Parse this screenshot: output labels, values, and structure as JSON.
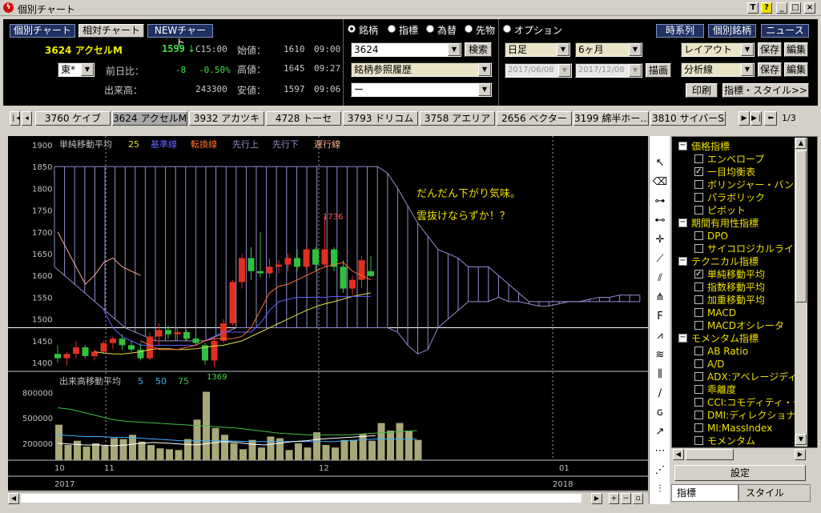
{
  "window": {
    "title": "個別チャート",
    "controls": [
      "T",
      "?",
      "_",
      "□",
      "×"
    ]
  },
  "nav": {
    "individual": "個別チャート",
    "relative": "相対チャート",
    "new": "NEWチャート"
  },
  "quote": {
    "code_name": "3624 アクセルM",
    "price": "1599",
    "arrow": "↓",
    "time_flag": "C15:00",
    "market": "東*",
    "prev_label": "前日比：",
    "prev_change": "-8",
    "prev_pct": "-0.50%",
    "volume_label": "出来高：",
    "volume": "243300",
    "open_label": "始値：",
    "open": "1610",
    "open_time": "09:00",
    "high_label": "高値：",
    "high": "1645",
    "high_time": "09:27",
    "low_label": "安値：",
    "low": "1597",
    "low_time": "09:06"
  },
  "radios": [
    {
      "label": "銘柄",
      "checked": true
    },
    {
      "label": "指標",
      "checked": false
    },
    {
      "label": "為替",
      "checked": false
    },
    {
      "label": "先物",
      "checked": false
    },
    {
      "label": "オプション",
      "checked": false
    }
  ],
  "search": {
    "code": "3624",
    "button": "検索",
    "history": "銘柄参照履歴",
    "third": "ー"
  },
  "period": {
    "type": "日足",
    "range": "6ヶ月",
    "from": "2017/06/08",
    "to": "2017/12/08",
    "draw": "描画"
  },
  "right_buttons": {
    "timeseries": "時系列",
    "individual": "個別銘柄",
    "news": "ニュース"
  },
  "layout": {
    "layout": "レイアウト",
    "save": "保存",
    "edit": "編集",
    "analysis": "分析線",
    "print": "印刷",
    "indicator_style": "指標・スタイル>>"
  },
  "tabs": [
    "3760 ケイブ",
    "3624 アクセルM",
    "3932 アカツキ",
    "4728 トーセ",
    "3793 ドリコム",
    "3758 アエリア",
    "2656 ベクター",
    "3199 綿半ホー…",
    "3810 サイバーS"
  ],
  "tab_page": "1/3",
  "chart": {
    "legend": {
      "sma": "単純移動平均",
      "sma_n": "25",
      "base": "基準線",
      "conv": "転換線",
      "lead1": "先行上",
      "lead2": "先行下",
      "lag": "遅行線"
    },
    "comment1": "だんだん下がり気味。",
    "comment2": "雲抜けならずか！？",
    "high_marker": "1736",
    "low_marker": "1369",
    "vol_legend": {
      "label": "出来高移動平均",
      "p1": "5",
      "p2": "50",
      "p3": "75"
    },
    "y_ticks": [
      "1900",
      "1850",
      "1800",
      "1750",
      "1700",
      "1650",
      "1600",
      "1550",
      "1500",
      "1450",
      "1400"
    ],
    "vol_ticks": [
      "800000",
      "500000",
      "200000"
    ],
    "x_months": [
      "10",
      "11",
      "12",
      "01"
    ],
    "x_years": [
      "2017",
      "2018"
    ],
    "colors": {
      "up": "#e03020",
      "down": "#30c040",
      "sma": "#e0e040",
      "base": "#6060ff",
      "conv": "#ff7030",
      "cloud": "#9090d0",
      "lag": "#ffb090"
    }
  },
  "chart_data": {
    "type": "candlestick",
    "ylim": [
      1380,
      1920
    ],
    "candles": [
      {
        "o": 1420,
        "h": 1440,
        "l": 1400,
        "c": 1410
      },
      {
        "o": 1410,
        "h": 1425,
        "l": 1395,
        "c": 1420
      },
      {
        "o": 1420,
        "h": 1450,
        "l": 1410,
        "c": 1435
      },
      {
        "o": 1435,
        "h": 1440,
        "l": 1410,
        "c": 1415
      },
      {
        "o": 1415,
        "h": 1430,
        "l": 1405,
        "c": 1425
      },
      {
        "o": 1425,
        "h": 1450,
        "l": 1420,
        "c": 1445
      },
      {
        "o": 1445,
        "h": 1460,
        "l": 1430,
        "c": 1455
      },
      {
        "o": 1455,
        "h": 1465,
        "l": 1430,
        "c": 1440
      },
      {
        "o": 1440,
        "h": 1450,
        "l": 1425,
        "c": 1430
      },
      {
        "o": 1430,
        "h": 1445,
        "l": 1405,
        "c": 1410
      },
      {
        "o": 1410,
        "h": 1470,
        "l": 1405,
        "c": 1460
      },
      {
        "o": 1460,
        "h": 1490,
        "l": 1440,
        "c": 1475
      },
      {
        "o": 1475,
        "h": 1485,
        "l": 1455,
        "c": 1465
      },
      {
        "o": 1465,
        "h": 1480,
        "l": 1450,
        "c": 1470
      },
      {
        "o": 1470,
        "h": 1475,
        "l": 1450,
        "c": 1455
      },
      {
        "o": 1455,
        "h": 1465,
        "l": 1440,
        "c": 1445
      },
      {
        "o": 1440,
        "h": 1445,
        "l": 1395,
        "c": 1405
      },
      {
        "o": 1405,
        "h": 1460,
        "l": 1390,
        "c": 1450
      },
      {
        "o": 1450,
        "h": 1500,
        "l": 1445,
        "c": 1490
      },
      {
        "o": 1490,
        "h": 1590,
        "l": 1485,
        "c": 1585
      },
      {
        "o": 1585,
        "h": 1650,
        "l": 1570,
        "c": 1640
      },
      {
        "o": 1640,
        "h": 1665,
        "l": 1590,
        "c": 1610
      },
      {
        "o": 1610,
        "h": 1700,
        "l": 1595,
        "c": 1605
      },
      {
        "o": 1605,
        "h": 1640,
        "l": 1595,
        "c": 1620
      },
      {
        "o": 1620,
        "h": 1635,
        "l": 1605,
        "c": 1625
      },
      {
        "o": 1625,
        "h": 1650,
        "l": 1610,
        "c": 1640
      },
      {
        "o": 1640,
        "h": 1660,
        "l": 1610,
        "c": 1620
      },
      {
        "o": 1620,
        "h": 1665,
        "l": 1615,
        "c": 1660
      },
      {
        "o": 1660,
        "h": 1665,
        "l": 1610,
        "c": 1625
      },
      {
        "o": 1625,
        "h": 1736,
        "l": 1620,
        "c": 1660
      },
      {
        "o": 1660,
        "h": 1665,
        "l": 1610,
        "c": 1620
      },
      {
        "o": 1620,
        "h": 1635,
        "l": 1560,
        "c": 1570
      },
      {
        "o": 1570,
        "h": 1600,
        "l": 1555,
        "c": 1590
      },
      {
        "o": 1590,
        "h": 1645,
        "l": 1570,
        "c": 1635
      },
      {
        "o": 1610,
        "h": 1645,
        "l": 1597,
        "c": 1599
      }
    ],
    "volume": [
      420000,
      180000,
      230000,
      160000,
      200000,
      170000,
      260000,
      250000,
      300000,
      220000,
      180000,
      140000,
      130000,
      120000,
      250000,
      480000,
      810000,
      380000,
      300000,
      200000,
      130000,
      240000,
      150000,
      280000,
      260000,
      120000,
      200000,
      150000,
      330000,
      180000,
      150000,
      240000,
      240000,
      310000,
      230000,
      440000,
      350000,
      440000,
      350000,
      240000
    ],
    "current_price_line": 1480
  },
  "side": {
    "items": [
      {
        "type": "group",
        "label": "価格指標"
      },
      {
        "type": "item",
        "label": "エンベロープ",
        "checked": false
      },
      {
        "type": "item",
        "label": "一目均衡表",
        "checked": true
      },
      {
        "type": "item",
        "label": "ボリンジャー・バンド",
        "checked": false
      },
      {
        "type": "item",
        "label": "パラボリック",
        "checked": false
      },
      {
        "type": "item",
        "label": "ピボット",
        "checked": false
      },
      {
        "type": "group",
        "label": "期間有用性指標"
      },
      {
        "type": "item",
        "label": "DPO",
        "checked": false
      },
      {
        "type": "item",
        "label": "サイコロジカルライン",
        "checked": false
      },
      {
        "type": "group",
        "label": "テクニカル指標"
      },
      {
        "type": "item",
        "label": "単純移動平均",
        "checked": true
      },
      {
        "type": "item",
        "label": "指数移動平均",
        "checked": false
      },
      {
        "type": "item",
        "label": "加重移動平均",
        "checked": false
      },
      {
        "type": "item",
        "label": "MACD",
        "checked": false
      },
      {
        "type": "item",
        "label": "MACDオシレータ",
        "checked": false
      },
      {
        "type": "group",
        "label": "モメンタム指標"
      },
      {
        "type": "item",
        "label": "AB Ratio",
        "checked": false
      },
      {
        "type": "item",
        "label": "A/D",
        "checked": false
      },
      {
        "type": "item",
        "label": "ADX:アベレージディレ",
        "checked": false
      },
      {
        "type": "item",
        "label": "乖離度",
        "checked": false
      },
      {
        "type": "item",
        "label": "CCI:コモディティ・チャ",
        "checked": false
      },
      {
        "type": "item",
        "label": "DMI:ディレクショナル",
        "checked": false
      },
      {
        "type": "item",
        "label": "MI:MassIndex",
        "checked": false
      },
      {
        "type": "item",
        "label": "モメンタム",
        "checked": false
      }
    ],
    "settings": "設定",
    "tab_indicators": "指標",
    "tab_style": "スタイル"
  },
  "tools": [
    "pointer-icon",
    "eraser-icon",
    "hline-icon",
    "vline-icon",
    "cross-icon",
    "trendline-icon",
    "fan-icon",
    "fib-icon",
    "fib-f-icon",
    "fib-arc-icon",
    "channel-icon",
    "fib-time-icon",
    "line-icon",
    "fib-g-icon",
    "ray-icon",
    "cycle-icon",
    "cycle2-icon",
    "bars-icon"
  ]
}
